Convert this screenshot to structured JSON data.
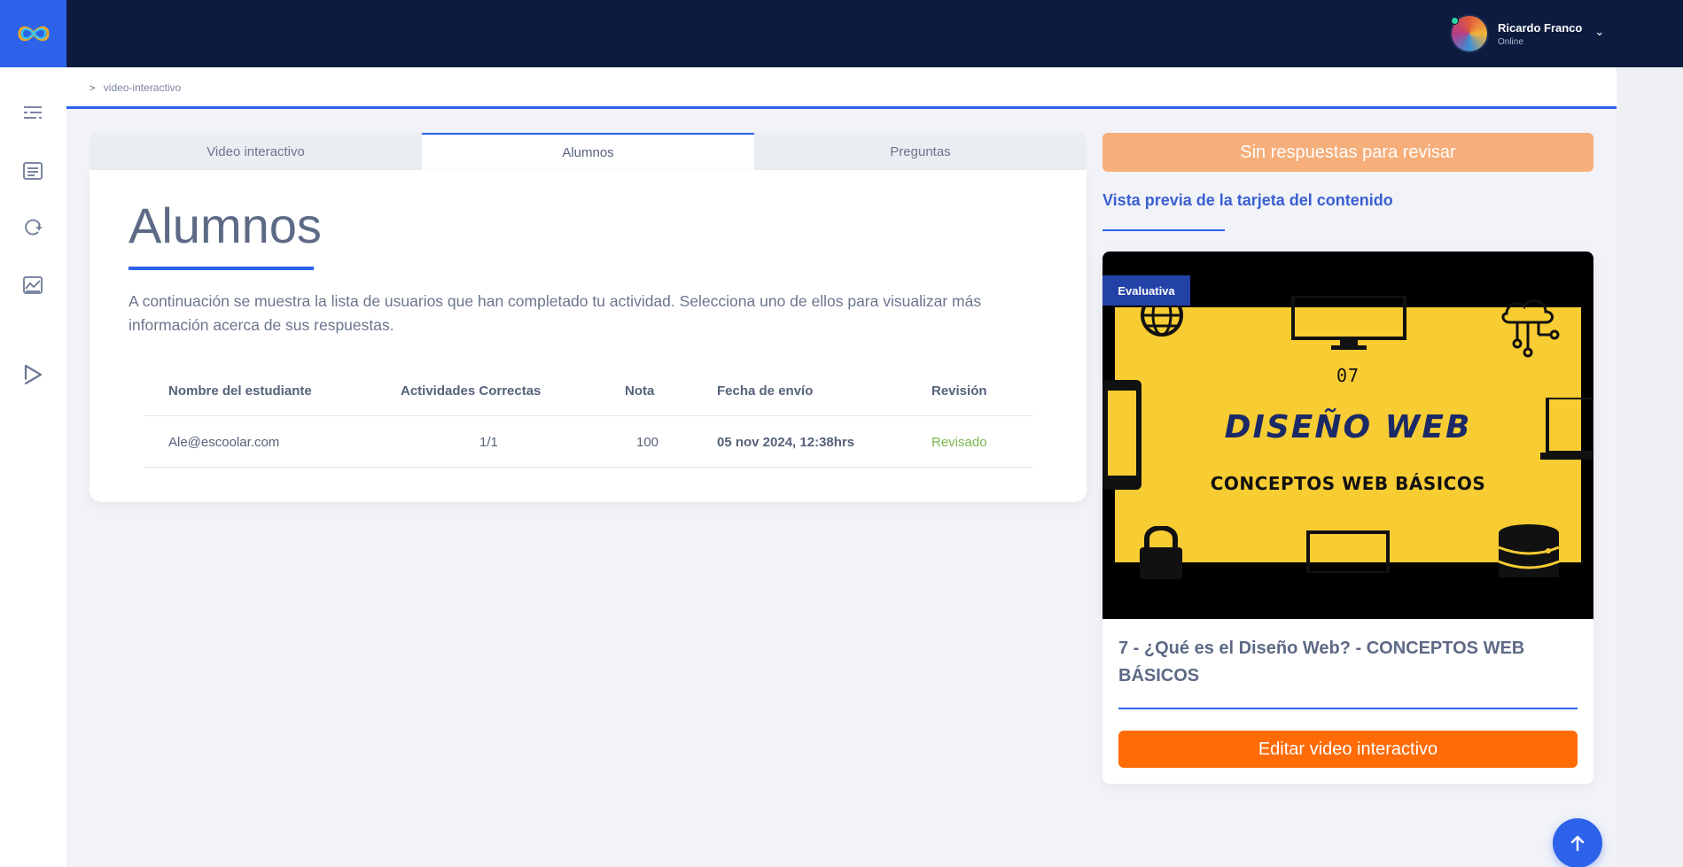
{
  "header": {
    "logo_icon": "infinity-logo",
    "user": {
      "name": "Ricardo Franco",
      "status": "Online",
      "menu_icon": "chevron-down-icon"
    }
  },
  "sidebar": {
    "items": [
      {
        "icon": "list-icon"
      },
      {
        "icon": "document-list-icon"
      },
      {
        "icon": "refresh-plus-icon"
      },
      {
        "icon": "chart-image-icon"
      },
      {
        "icon": "play-icon"
      }
    ]
  },
  "breadcrumb": {
    "separator": ">",
    "current": "video-interactivo"
  },
  "tabs": [
    {
      "label": "Video interactivo",
      "active": false
    },
    {
      "label": "Alumnos",
      "active": true
    },
    {
      "label": "Preguntas",
      "active": false
    }
  ],
  "main": {
    "title": "Alumnos",
    "description": "A continuación se muestra la lista de usuarios que han completado tu actividad. Selecciona uno de ellos para visualizar más información acerca de sus respuestas.",
    "table": {
      "headers": [
        "Nombre del estudiante",
        "Actividades Correctas",
        "Nota",
        "Fecha de envío",
        "Revisión"
      ],
      "rows": [
        [
          "Ale@escoolar.com",
          "1/1",
          "100",
          "05 nov 2024, 12:38hrs",
          "Revisado"
        ]
      ]
    }
  },
  "side_panel": {
    "no_answers_label": "Sin respuestas para revisar",
    "preview_label": "Vista previa de la tarjeta del contenido",
    "card": {
      "badge": "Evaluativa",
      "thumbnail": {
        "number": "07",
        "headline": "DISEÑO WEB",
        "subheadline": "CONCEPTOS WEB BÁSICOS"
      },
      "title": "7 - ¿Qué es el Diseño Web? - CONCEPTOS WEB BÁSICOS",
      "edit_button_label": "Editar video interactivo"
    }
  },
  "scroll_top_icon": "arrow-up-icon",
  "colors": {
    "topbar": "#0c1b3f",
    "accent_blue": "#2d62ea",
    "no_answers_orange": "#f6ae7a",
    "edit_orange": "#ff6b07",
    "reviewed_green": "#7ab648",
    "badge_blue": "#2342a8",
    "thumbnail_yellow": "#f8cc33"
  }
}
